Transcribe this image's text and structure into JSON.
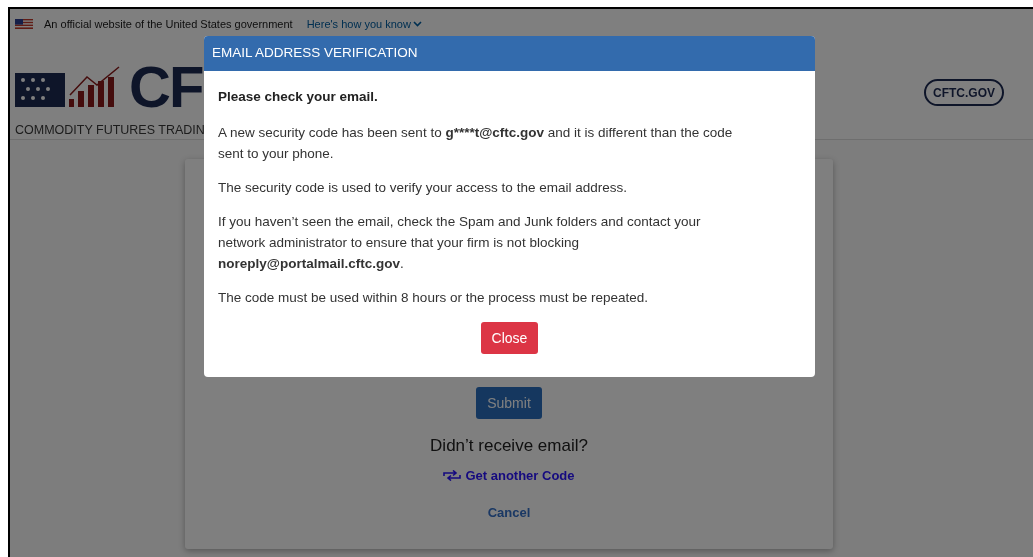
{
  "banner": {
    "text": "An official website of the United States government",
    "link": "Here's how you know"
  },
  "header": {
    "logo_text": "CF",
    "logo_subtitle": "COMMODITY FUTURES TRADIN",
    "site_button": "CFTC.GOV"
  },
  "card": {
    "submit_button": "Submit",
    "prompt": "Didn’t receive email?",
    "resend_link": "Get another Code",
    "cancel_link": "Cancel"
  },
  "modal": {
    "title": "EMAIL ADDRESS VERIFICATION",
    "heading": "Please check your email.",
    "paragraphs": [
      [
        {
          "text": "A new security code has been sent to ",
          "bold": false
        },
        {
          "text": "g****t@cftc.gov",
          "bold": true
        },
        {
          "text": " and it is different than the code sent to your phone.",
          "bold": false
        }
      ],
      [
        {
          "text": "The security code is used to verify your access to the email address.",
          "bold": false
        }
      ],
      [
        {
          "text": "If you haven’t seen the email, check the Spam and Junk folders and contact your network administrator to ensure that your firm is not blocking ",
          "bold": false
        },
        {
          "text": "noreply@portalmail.cftc.gov",
          "bold": true
        },
        {
          "text": ".",
          "bold": false
        }
      ],
      [
        {
          "text": "The code must be used within 8 hours or the process must be repeated.",
          "bold": false
        }
      ]
    ],
    "close_button": "Close"
  }
}
